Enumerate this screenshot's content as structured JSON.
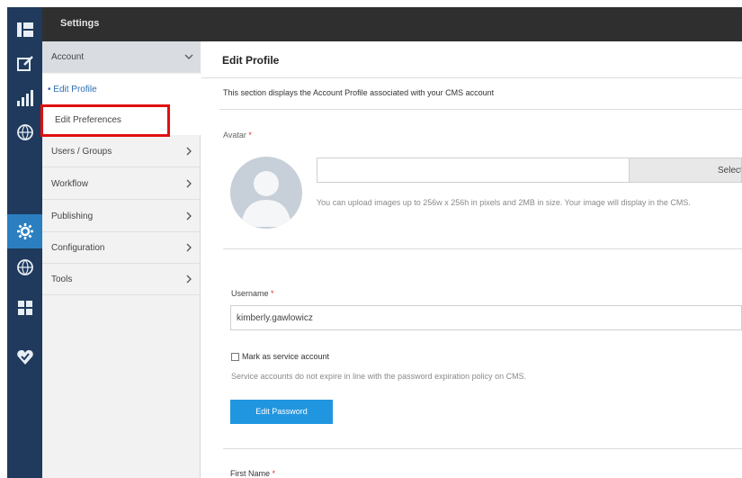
{
  "topbar": {
    "title": "Settings"
  },
  "rail": {
    "items": [
      {
        "icon": "dashboard-grid-icon",
        "active": false
      },
      {
        "icon": "edit-square-icon",
        "active": false
      },
      {
        "icon": "bar-chart-icon",
        "active": false
      },
      {
        "icon": "wcd-globe-icon",
        "active": false
      },
      {
        "icon": "gear-icon",
        "active": true
      },
      {
        "icon": "dgm-globe-icon",
        "active": false
      },
      {
        "icon": "modules-grid-icon",
        "active": false
      },
      {
        "icon": "heart-check-icon",
        "active": false
      }
    ]
  },
  "menu": {
    "account_label": "Account",
    "edit_profile_label": "• Edit Profile",
    "edit_preferences_label": "Edit Preferences",
    "items": [
      {
        "label": "Users / Groups"
      },
      {
        "label": "Workflow"
      },
      {
        "label": "Publishing"
      },
      {
        "label": "Configuration"
      },
      {
        "label": "Tools"
      }
    ]
  },
  "content": {
    "title": "Edit Profile",
    "description": "This section displays the Account Profile associated with your CMS account",
    "avatar_label": "Avatar",
    "required_mark": "*",
    "select_button_label": "Select",
    "upload_hint": "You can upload images up to 256w x 256h in pixels and 2MB in size. Your image will display in the CMS.",
    "username_label": "Username",
    "username_value": "kimberly.gawlowicz",
    "service_account_label": "Mark as service account",
    "service_account_hint": "Service accounts do not expire in line with the password expiration policy on CMS.",
    "edit_password_label": "Edit Password",
    "first_name_label": "First Name"
  },
  "colors": {
    "rail_bg": "#1f3a5c",
    "rail_active": "#2b7fc0",
    "topbar_bg": "#2f2f2f",
    "primary_button": "#2196e0",
    "highlight": "#e01010"
  }
}
